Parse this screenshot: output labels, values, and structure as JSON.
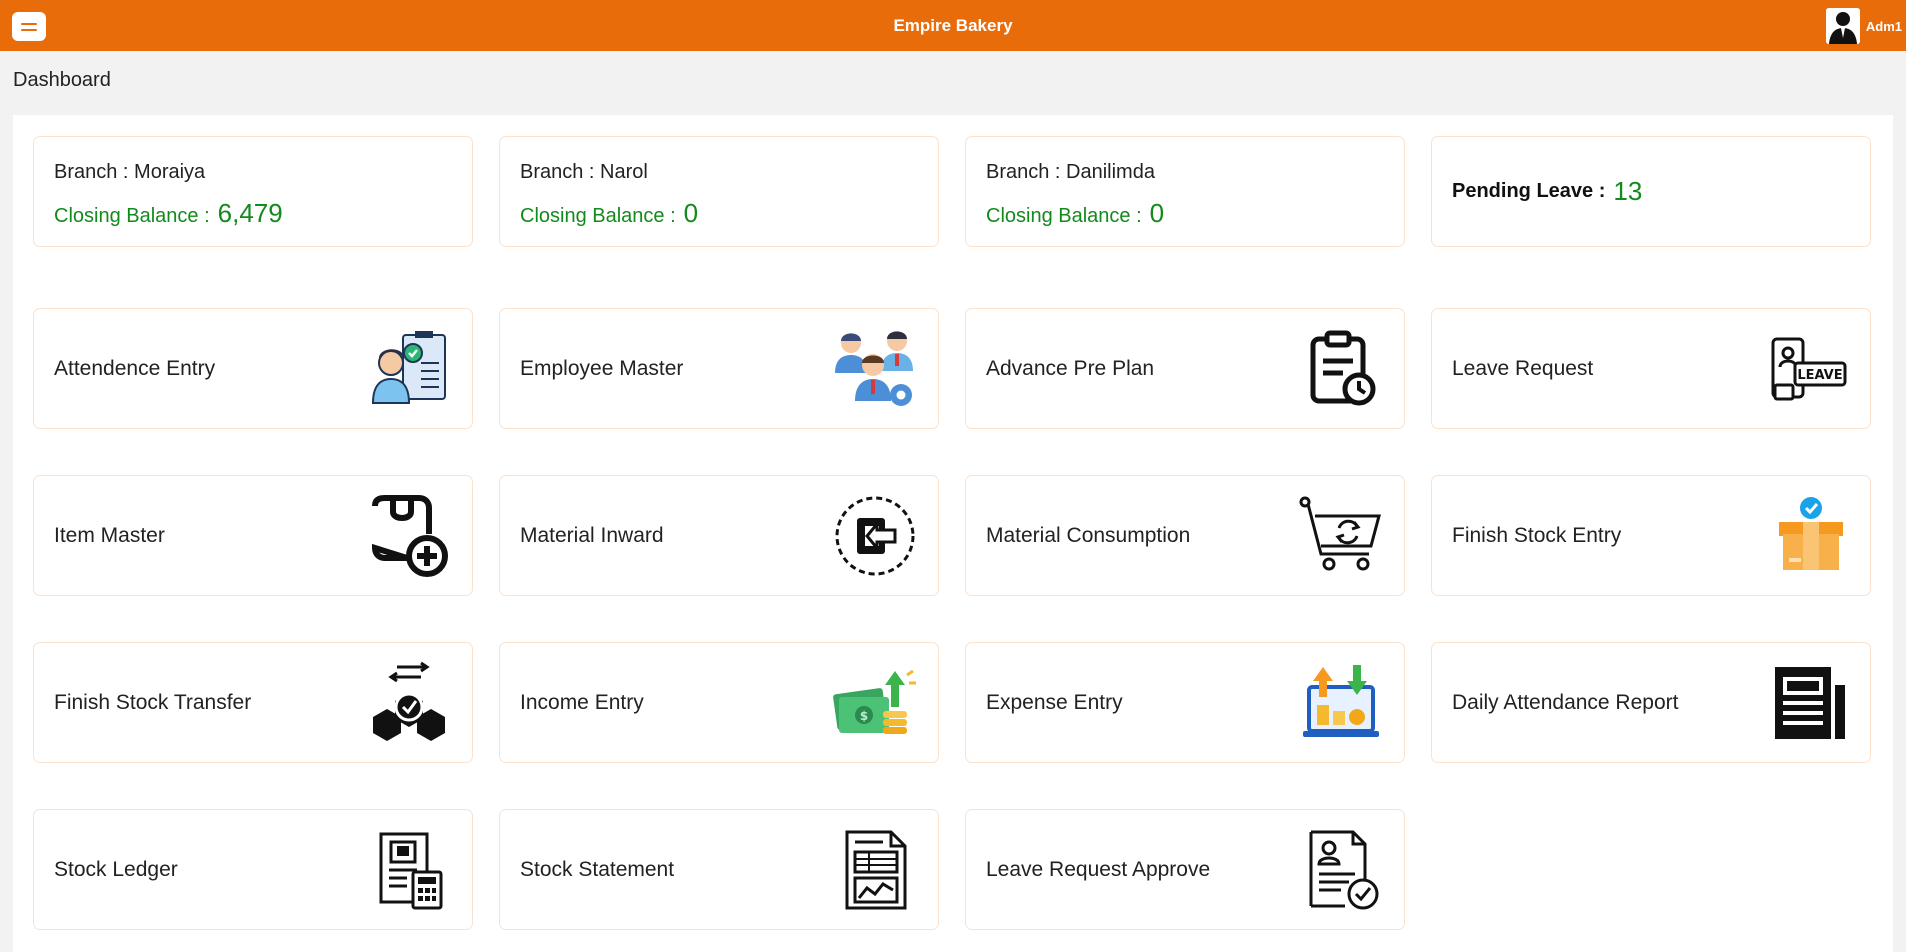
{
  "header": {
    "app_title": "Empire Bakery",
    "user_name": "Adm1"
  },
  "page_title": "Dashboard",
  "branches": [
    {
      "label": "Branch : Moraiya",
      "balance_label": "Closing Balance :",
      "balance": "6,479"
    },
    {
      "label": "Branch : Narol",
      "balance_label": "Closing Balance :",
      "balance": "0"
    },
    {
      "label": "Branch : Danilimda",
      "balance_label": "Closing Balance :",
      "balance": "0"
    }
  ],
  "pending_leave": {
    "label": "Pending Leave :",
    "value": "13"
  },
  "tiles": [
    {
      "label": "Attendence Entry",
      "icon": "attendance-clipboard-icon"
    },
    {
      "label": "Employee Master",
      "icon": "employee-group-icon"
    },
    {
      "label": "Advance Pre Plan",
      "icon": "clipboard-clock-icon"
    },
    {
      "label": "Leave Request",
      "icon": "leave-card-icon"
    },
    {
      "label": "Item Master",
      "icon": "item-add-icon"
    },
    {
      "label": "Material Inward",
      "icon": "inward-arrow-icon"
    },
    {
      "label": "Material Consumption",
      "icon": "cart-recycle-icon"
    },
    {
      "label": "Finish Stock Entry",
      "icon": "box-check-icon"
    },
    {
      "label": "Finish Stock Transfer",
      "icon": "boxes-transfer-icon"
    },
    {
      "label": "Income Entry",
      "icon": "money-up-icon"
    },
    {
      "label": "Expense Entry",
      "icon": "laptop-coins-icon"
    },
    {
      "label": "Daily Attendance Report",
      "icon": "report-document-icon"
    },
    {
      "label": "Stock Ledger",
      "icon": "ledger-calculator-icon"
    },
    {
      "label": "Stock Statement",
      "icon": "statement-chart-icon"
    },
    {
      "label": "Leave Request Approve",
      "icon": "approve-document-icon"
    }
  ],
  "colors": {
    "header": "#e96c0b",
    "balance_green": "#138a1c",
    "card_border": "#fbe2cf"
  }
}
